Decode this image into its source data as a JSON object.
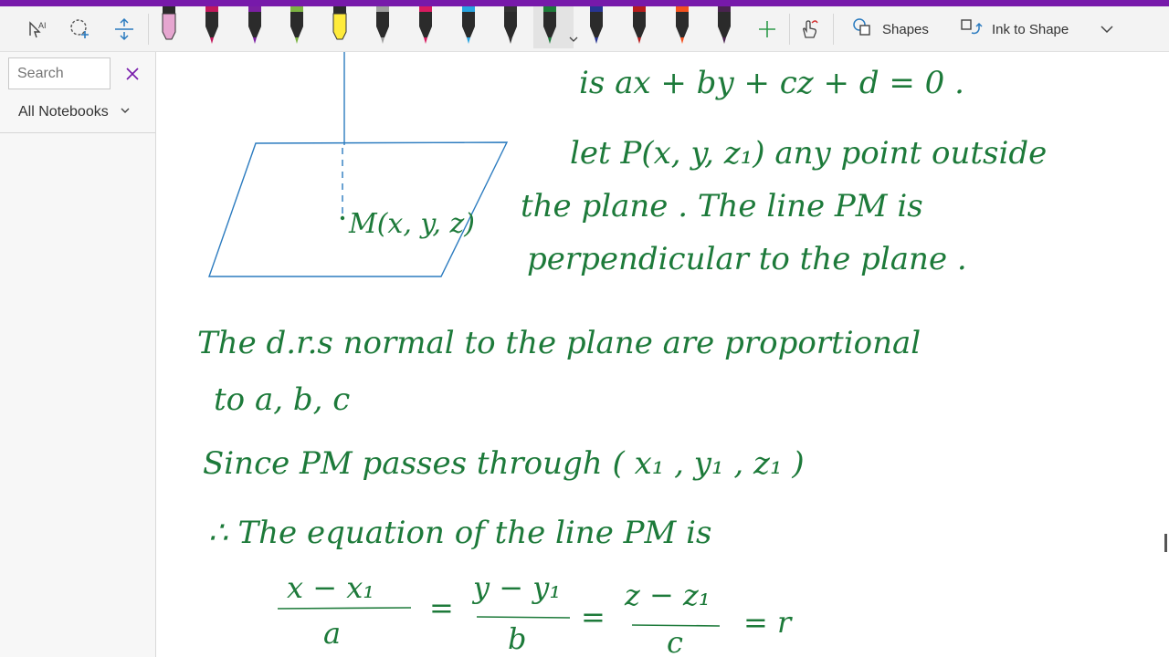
{
  "colors": {
    "accent": "#7719aa",
    "ink_green": "#1d7a3a",
    "ink_blue": "#2b7bbf"
  },
  "toolbar": {
    "tools": [
      {
        "icon": "lasso-text-select-icon"
      },
      {
        "icon": "lasso-select-icon"
      },
      {
        "icon": "add-space-icon"
      }
    ],
    "pens": [
      {
        "color": "#e6a6d0",
        "kind": "highlighter-pink"
      },
      {
        "color": "#c2185b",
        "kind": "pen"
      },
      {
        "color": "#7b1fa2",
        "kind": "pen"
      },
      {
        "color": "#7cb342",
        "kind": "pen"
      },
      {
        "color": "#ffeb3b",
        "kind": "highlighter-yellow"
      },
      {
        "color": "#9e9e9e",
        "kind": "pen-pattern"
      },
      {
        "color": "#d81b60",
        "kind": "pen"
      },
      {
        "color": "#29a3e0",
        "kind": "pen"
      },
      {
        "color": "#333333",
        "kind": "pen"
      },
      {
        "color": "#1d7a3a",
        "kind": "pen-selected"
      },
      {
        "color": "#283593",
        "kind": "pen"
      },
      {
        "color": "#b71c1c",
        "kind": "pen"
      },
      {
        "color": "#f4511e",
        "kind": "pen"
      },
      {
        "color": "#4a2350",
        "kind": "pen"
      }
    ],
    "shapes_label": "Shapes",
    "ink_to_shape_label": "Ink to Shape"
  },
  "sidebar": {
    "search_placeholder": "Search",
    "notebooks_label": "All Notebooks"
  },
  "notes": {
    "line1": "is  ax + by + cz + d = 0 .",
    "line2": "let  P(x, y, z₁)  any point outside",
    "line3": "the plane . The line PM is",
    "line4": "perpendicular to the plane .",
    "point_label": "M(x, y, z)",
    "line5": "The d.r.s normal to the plane are proportional",
    "line6": "to  a, b, c",
    "line7": "Since  PM passes through ( x₁ , y₁ , z₁ )",
    "line8": "∴ The equation of the line PM is",
    "frac1_num": "x − x₁",
    "frac1_den": "a",
    "frac2_num": "y − y₁",
    "frac2_den": "b",
    "frac3_num": "z − z₁",
    "frac3_den": "c",
    "equals": "=",
    "ratio": "= r"
  }
}
